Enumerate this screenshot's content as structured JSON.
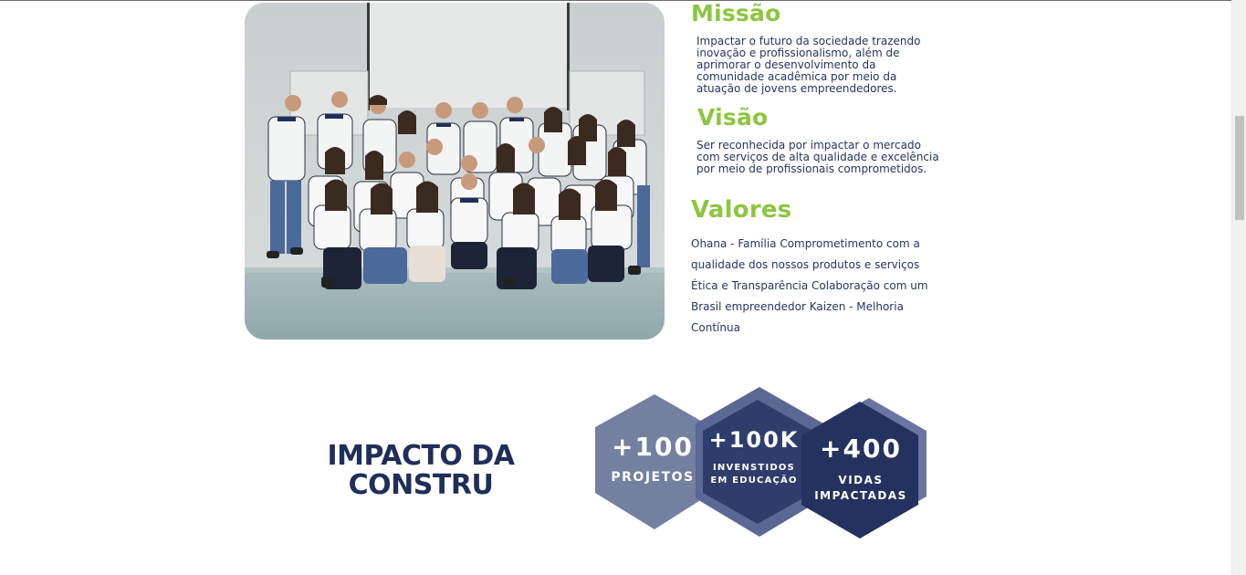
{
  "mission": {
    "title": "Missão",
    "text": "Impactar o futuro da sociedade trazendo inovação e profissionalismo, além de aprimorar o desenvolvimento da comunidade acadêmica por meio da atuação de jovens empreendedores."
  },
  "vision": {
    "title": "Visão",
    "text": "Ser reconhecida por impactar o mercado com serviços de alta qualidade e excelência por meio de profissionais comprometidos."
  },
  "values": {
    "title": "Valores",
    "text": "Ohana - Família Comprometimento com a qualidade dos nossos produtos e serviços Ética e Transparência Colaboração com um Brasil empreendedor Kaizen - Melhoria Contínua"
  },
  "impact": {
    "title_line1": "IMPACTO DA",
    "title_line2": "CONSTRU",
    "stats": [
      {
        "number": "+100",
        "label_line1": "PROJETOS",
        "label_line2": ""
      },
      {
        "number": "+100K",
        "label_line1": "INVENSTIDOS",
        "label_line2": "EM EDUCAÇÃO"
      },
      {
        "number": "+400",
        "label_line1": "VIDAS",
        "label_line2": "IMPACTADAS"
      }
    ]
  },
  "colors": {
    "accent_green": "#8cc63f",
    "navy": "#1f2e5a",
    "hex_light": "#7480a0",
    "hex_mid": "#5b6894",
    "hex_dark": "#23325e"
  },
  "photo": {
    "icon": "team-photo"
  }
}
